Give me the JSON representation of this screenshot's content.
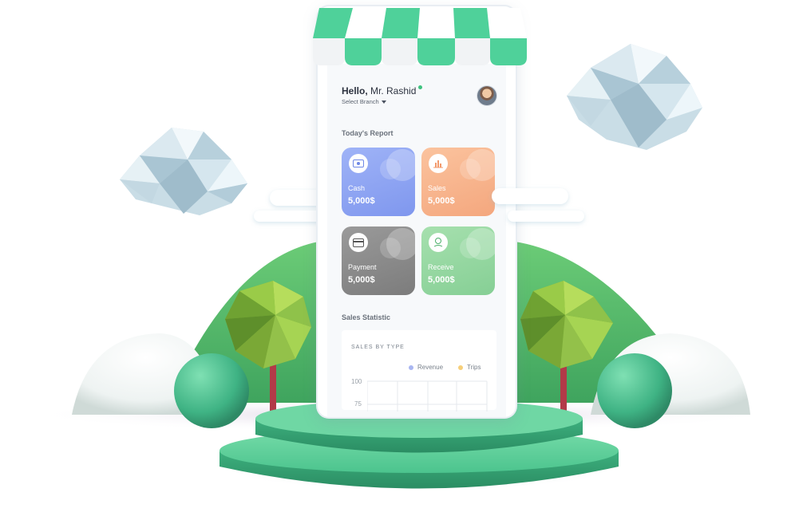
{
  "app": {
    "greeting_prefix": "Hello,",
    "user_name": "Mr. Rashid",
    "branch_selector": "Select Branch"
  },
  "report": {
    "title": "Today's Report",
    "cards": [
      {
        "label": "Cash",
        "value": "5,000$",
        "icon": "cash-icon",
        "color": "#8fa6f2"
      },
      {
        "label": "Sales",
        "value": "5,000$",
        "icon": "bar-chart-icon",
        "color": "#f7b58e"
      },
      {
        "label": "Payment",
        "value": "5,000$",
        "icon": "credit-card-icon",
        "color": "#8c8c8c"
      },
      {
        "label": "Receive",
        "value": "5,000$",
        "icon": "money-hand-icon",
        "color": "#93d69f"
      }
    ]
  },
  "statistic": {
    "title": "Sales Statistic",
    "chart_title": "SALES BY TYPE",
    "legend": [
      {
        "name": "Revenue",
        "color": "#a9b6f1"
      },
      {
        "name": "Trips",
        "color": "#f6cf7a"
      }
    ],
    "y_ticks": [
      "100",
      "75"
    ]
  },
  "colors": {
    "awning_green": "#4fd19a",
    "podium_green": "#48c08a",
    "hill_green": "#5bbf6f",
    "tree_green": "#8cc63f",
    "trunk": "#b23a48"
  }
}
